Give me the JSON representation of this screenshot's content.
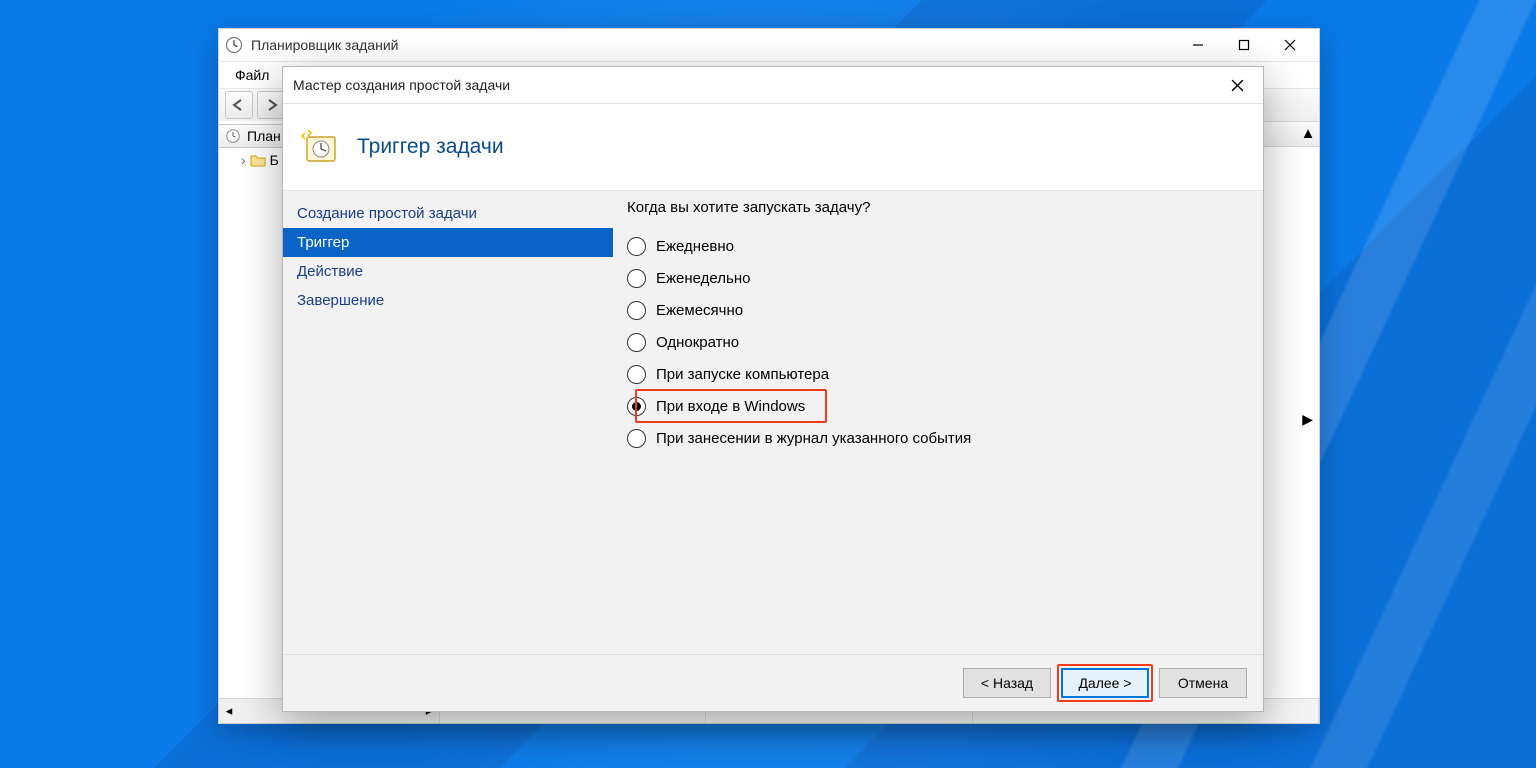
{
  "scheduler": {
    "title": "Планировщик заданий",
    "menu_file": "Файл",
    "tree_root": "План",
    "tree_child": "Б"
  },
  "wizard": {
    "window_title": "Мастер создания простой задачи",
    "heading": "Триггер задачи",
    "nav": {
      "create": "Создание простой задачи",
      "trigger": "Триггер",
      "action": "Действие",
      "finish": "Завершение"
    },
    "question": "Когда вы хотите запускать задачу?",
    "options": {
      "daily": "Ежедневно",
      "weekly": "Еженедельно",
      "monthly": "Ежемесячно",
      "once": "Однократно",
      "startup": "При запуске компьютера",
      "logon": "При входе в Windows",
      "event": "При занесении в журнал указанного события"
    },
    "buttons": {
      "back": "< Назад",
      "next": "Далее >",
      "cancel": "Отмена"
    }
  }
}
